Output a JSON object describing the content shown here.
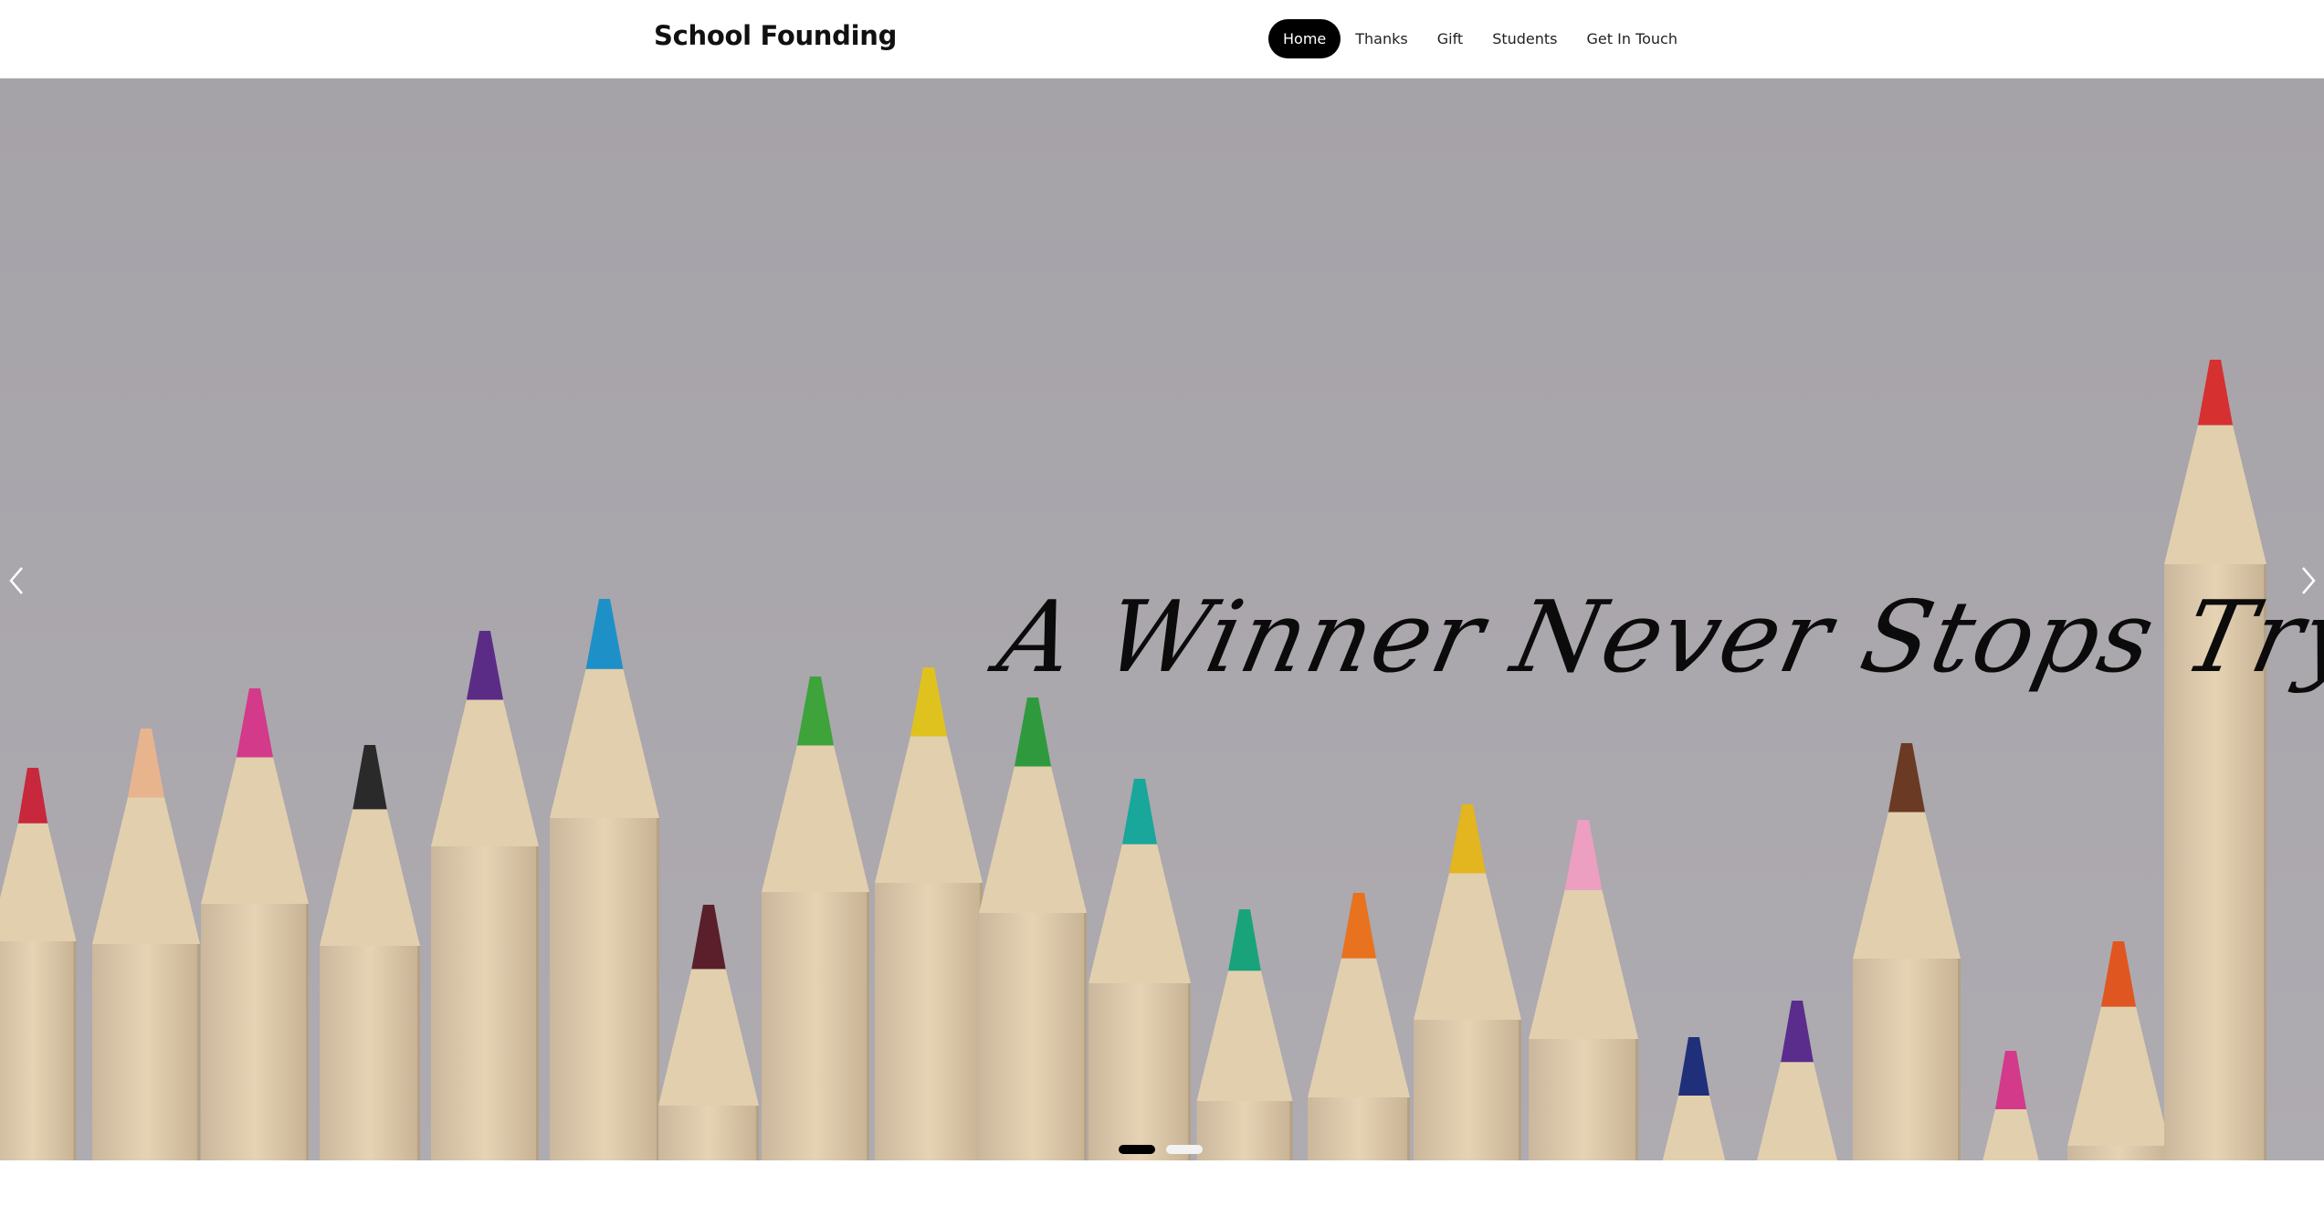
{
  "header": {
    "brand": "School Founding",
    "nav": [
      {
        "label": "Home",
        "active": true
      },
      {
        "label": "Thanks",
        "active": false
      },
      {
        "label": "Gift",
        "active": false
      },
      {
        "label": "Students",
        "active": false
      },
      {
        "label": "Get In Touch",
        "active": false
      }
    ]
  },
  "hero": {
    "slogan": "A Winner Never Stops Trying !",
    "image": "colored-pencils",
    "prev_icon": "chevron-left-icon",
    "next_icon": "chevron-right-icon",
    "slides": 2,
    "active_slide": 1
  },
  "colors": {
    "nav_active_bg": "#000000",
    "nav_active_text": "#ffffff",
    "hero_background": "#a9a6ac",
    "dot_active": "#000000",
    "dot_inactive": "#f2f2f2"
  }
}
